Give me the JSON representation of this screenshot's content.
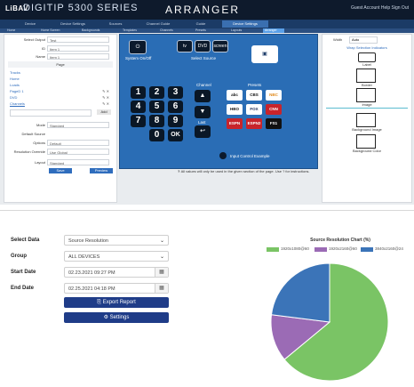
{
  "app": {
    "brand": "LiBAV",
    "product": "DIGITIP 5300 SERIES",
    "title": "ARRANGER",
    "right_info": "Guest Account   Help   Sign Out",
    "nav_tabs": [
      "Device",
      "Device Settings",
      "Sources",
      "Channel Guide",
      "Guide",
      "Device Settings"
    ],
    "active_nav": 5,
    "sub_tabs": [
      "Home",
      "Home Screen",
      "Backgrounds",
      "Templates",
      "Channels",
      "Presets",
      "Layouts",
      "Arranger"
    ],
    "active_sub": 7
  },
  "left_panel": {
    "select_output_label": "Select Output",
    "select_output_value": "Test",
    "id_label": "ID",
    "id_value": "Item 1",
    "name_label": "Name",
    "name_value": "Item 1",
    "pages_header": "Page",
    "pages": [
      "Tracks",
      "Home",
      "Loads",
      "PageD 1",
      "DVD",
      "Channels"
    ],
    "add_label": "Add",
    "mode_label": "Mode",
    "mode_value": "Standard",
    "default_source_label": "Default Source",
    "defaut_option_label": "Options",
    "default_option_value": "Default",
    "resolution_label": "Resolution Override",
    "resolution_value": "Use Global",
    "layout_label": "Layout",
    "layout_value": "Standard",
    "save_label": "Save",
    "preview_label": "Preview"
  },
  "canvas": {
    "system_on_off": "System On/Off",
    "select_source": "Select Source",
    "channel_label": "Channel",
    "presets_label": "Presets",
    "last_label": "Last",
    "keypad": [
      "1",
      "2",
      "3",
      "4",
      "5",
      "6",
      "7",
      "8",
      "9",
      "0",
      "OK"
    ],
    "logos": [
      "abc",
      "CBS",
      "NBC",
      "HBO",
      "FOX",
      "CNN",
      "ESPN",
      "ESPN2",
      "FS1"
    ],
    "input_control_label": "Input Control Example",
    "source_icons": [
      "tv",
      "DVD",
      "screen"
    ]
  },
  "hint": "All values will only be used in the given section of the page. Use ? for instructions.",
  "right_panel": {
    "width_label": "Width",
    "width_value": "Auto",
    "wrap_label": "Wrap Selection Indicators",
    "items": [
      "Label",
      "Border",
      "Image",
      "Background Image",
      "Background Color"
    ]
  },
  "report": {
    "select_data_label": "Select Data",
    "select_data_value": "Source Resolution",
    "group_label": "Group",
    "group_value": "ALL DEVICES",
    "start_date_label": "Start Date",
    "start_date_value": "02.23.2021 09:27 PM",
    "end_date_label": "End Date",
    "end_date_value": "02.25.2021 04:18 PM",
    "export_label": "Export Report",
    "settings_label": "Settings"
  },
  "chart_data": {
    "type": "pie",
    "title": "Source Resolution Chart (%)",
    "series": [
      {
        "name": "1920x1080@60",
        "value": 64,
        "color": "#7ac465"
      },
      {
        "name": "1920x2160@60",
        "value": 13,
        "color": "#9b6bb5"
      },
      {
        "name": "3840x2160@24",
        "value": 23,
        "color": "#3b74b8"
      }
    ],
    "legend_position": "top"
  }
}
